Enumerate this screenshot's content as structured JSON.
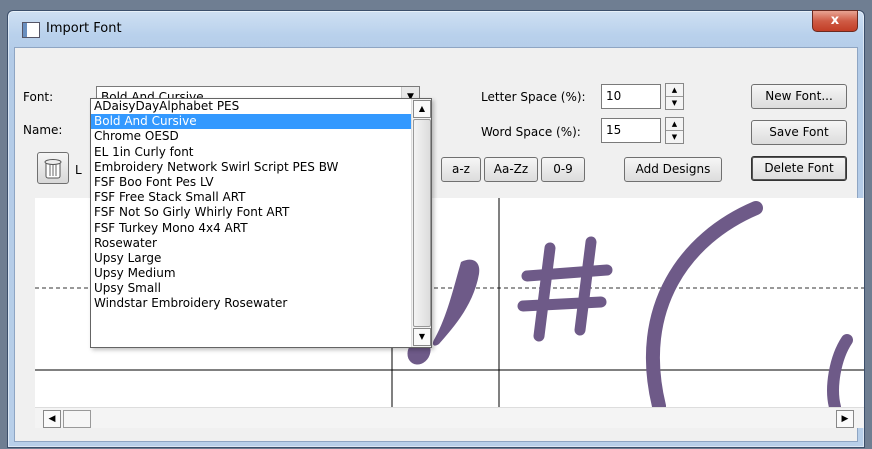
{
  "window": {
    "title": "Import Font",
    "close_glyph": "x"
  },
  "form": {
    "font_label": "Font:",
    "font_value": "Bold And Cursive",
    "name_label": "Name:",
    "l_label_partial": "L",
    "letter_space_label": "Letter Space (%):",
    "letter_space_value": "10",
    "word_space_label": "Word Space (%):",
    "word_space_value": "15"
  },
  "buttons": {
    "new_font": "New Font...",
    "save_font": "Save Font",
    "delete_font": "Delete Font",
    "lower": "a-z",
    "mixed": "Aa-Zz",
    "digits": "0-9",
    "add_designs": "Add Designs"
  },
  "dropdown": {
    "items": [
      "ADaisyDayAlphabet PES",
      "Bold And Cursive",
      "Chrome OESD",
      "EL 1in Curly font",
      "Embroidery Network Swirl Script PES BW",
      "FSF Boo Font Pes LV",
      "FSF Free Stack Small ART",
      "FSF Not So Girly Whirly Font ART",
      "FSF Turkey Mono 4x4 ART",
      "Rosewater",
      "Upsy Large",
      "Upsy Medium",
      "Upsy Small",
      "Windstar Embroidery Rosewater"
    ],
    "selected_index": 1
  },
  "preview": {
    "glyphs": [
      "!",
      "#",
      "("
    ],
    "stitch_color": "#6e5a88"
  },
  "icons": [
    "window-icon",
    "trash-icon",
    "chevron-down-icon",
    "arrow-up-icon",
    "arrow-down-icon",
    "arrow-left-icon",
    "arrow-right-icon"
  ]
}
